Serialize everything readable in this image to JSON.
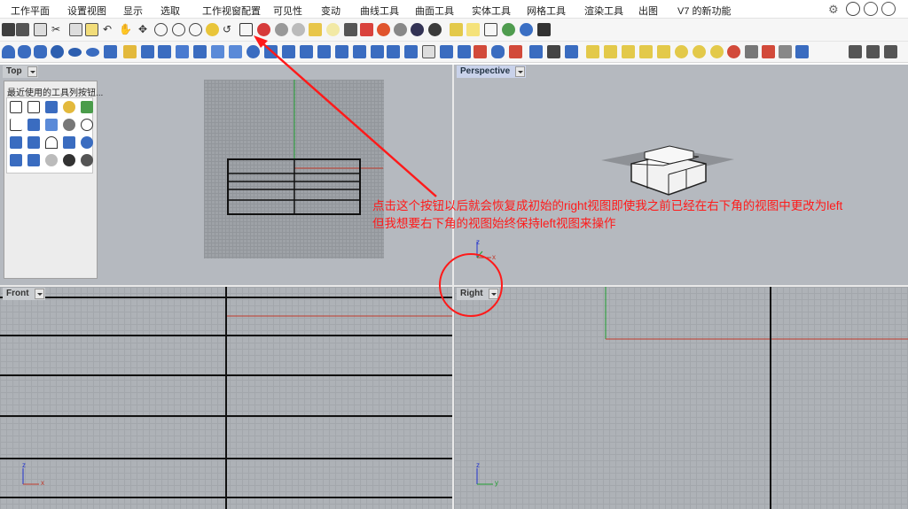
{
  "menu": {
    "items": [
      "工作平面",
      "设置视图",
      "显示",
      "选取",
      "工作视窗配置",
      "可见性",
      "变动",
      "曲线工具",
      "曲面工具",
      "实体工具",
      "网格工具",
      "渲染工具",
      "出图",
      "V7 的新功能"
    ],
    "settings_icon": "gear-icon"
  },
  "viewports": {
    "top": {
      "label": "Top"
    },
    "perspective": {
      "label": "Perspective"
    },
    "front": {
      "label": "Front"
    },
    "right": {
      "label": "Right"
    }
  },
  "tool_panel": {
    "title": "最近使用的工具列按钮..."
  },
  "axis": {
    "x": "x",
    "y": "y",
    "z": "z"
  },
  "annotation": {
    "line1": "点击这个按钮以后就会恢复成初始的right视图即使我之前已经在右下角的视图中更改为left",
    "line2": "但我想要右下角的视图始终保持left视图来操作",
    "color": "#ff1a1a"
  },
  "colors": {
    "viewport_bg": "#b5b9bf",
    "x_axis": "#c0392b",
    "y_axis": "#1f9d2f",
    "z_axis": "#2233cc"
  }
}
